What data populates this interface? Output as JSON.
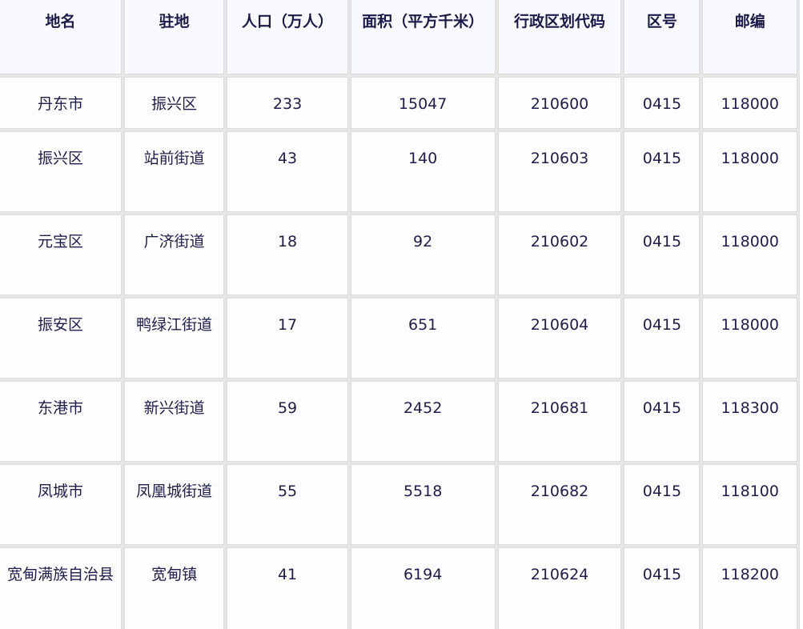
{
  "table": {
    "headers": [
      "地名",
      "驻地",
      "人口（万人）",
      "面积（平方千米）",
      "行政区划代码",
      "区号",
      "邮编"
    ],
    "rows": [
      [
        "丹东市",
        "振兴区",
        "233",
        "15047",
        "210600",
        "0415",
        "118000"
      ],
      [
        "振兴区",
        "站前街道",
        "43",
        "140",
        "210603",
        "0415",
        "118000"
      ],
      [
        "元宝区",
        "广济街道",
        "18",
        "92",
        "210602",
        "0415",
        "118000"
      ],
      [
        "振安区",
        "鸭绿江街道",
        "17",
        "651",
        "210604",
        "0415",
        "118000"
      ],
      [
        "东港市",
        "新兴街道",
        "59",
        "2452",
        "210681",
        "0415",
        "118300"
      ],
      [
        "凤城市",
        "凤凰城街道",
        "55",
        "5518",
        "210682",
        "0415",
        "118100"
      ],
      [
        "宽甸满族自治县",
        "宽甸镇",
        "41",
        "6194",
        "210624",
        "0415",
        "118200"
      ]
    ]
  },
  "colors": {
    "header_bg": "#f7f9fe",
    "cell_bg": "#fdfdff",
    "grid": "#e6e6e6",
    "text": "#1f1d4a"
  }
}
